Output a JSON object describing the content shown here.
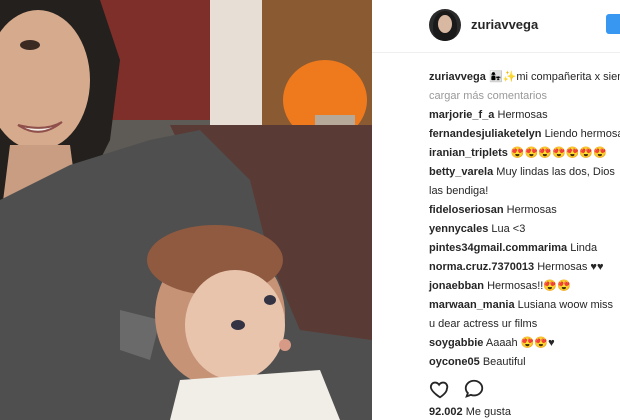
{
  "post": {
    "username": "zuriavvega",
    "caption_user": "zuriavvega",
    "caption_text": "👩‍👧✨mi compañerita x siempre",
    "load_more": "cargar más comentarios",
    "comments": [
      {
        "user": "marjorie_f_a",
        "text": "Hermosas"
      },
      {
        "user": "fernandesjuliaketelyn",
        "text": "Liendo hermosas"
      },
      {
        "user": "iranian_triplets",
        "text": "😍😍😍😍😍😍😍"
      },
      {
        "user": "betty_varela",
        "text": "Muy lindas las dos, Dios las bendiga!"
      },
      {
        "user": "fideloseriosan",
        "text": "Hermosas"
      },
      {
        "user": "yennycales",
        "text": "Lua <3"
      },
      {
        "user": "pintes34gmail.commarima",
        "text": "Linda"
      },
      {
        "user": "norma.cruz.7370013",
        "text": "Hermosas ♥♥"
      },
      {
        "user": "jonaebban",
        "text": "Hermosas!!😍😍"
      },
      {
        "user": "marwaan_mania",
        "text": "Lusiana woow miss u dear actress ur films"
      },
      {
        "user": "soygabbie",
        "text": "Aaaah 😍😍♥"
      },
      {
        "user": "oycone05",
        "text": "Beautiful"
      }
    ],
    "likes_count": "92.002",
    "likes_label": "Me gusta"
  },
  "icons": {
    "like": "heart-outline-icon",
    "comment": "speech-bubble-icon",
    "follow": "follow-button"
  },
  "colors": {
    "text": "#262626",
    "muted": "#999999",
    "accent": "#3897f0"
  }
}
